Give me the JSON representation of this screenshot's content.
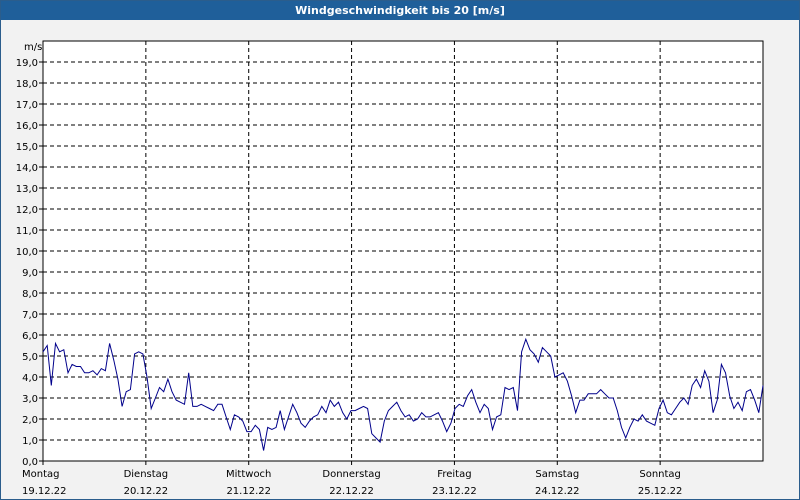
{
  "window": {
    "title": "Windgeschwindigkeit bis 20 [m/s]"
  },
  "colors": {
    "titlebar": "#1f5f9a",
    "series": "#00008b",
    "grid": "#000000",
    "plot_bg": "#ffffff"
  },
  "chart_data": {
    "type": "line",
    "title": "Windgeschwindigkeit bis 20 [m/s]",
    "ylabel": "m/s",
    "ylim": [
      0,
      20
    ],
    "yticks": [
      "0,0",
      "1,0",
      "2,0",
      "3,0",
      "4,0",
      "5,0",
      "6,0",
      "7,0",
      "8,0",
      "9,0",
      "10,0",
      "11,0",
      "12,0",
      "13,0",
      "14,0",
      "15,0",
      "16,0",
      "17,0",
      "18,0",
      "19,0"
    ],
    "xlim": [
      0,
      7
    ],
    "x_unit": "days from Montag 19.12.22",
    "xticks": [
      {
        "day": "Montag",
        "date": "19.12.22"
      },
      {
        "day": "Dienstag",
        "date": "20.12.22"
      },
      {
        "day": "Mittwoch",
        "date": "21.12.22"
      },
      {
        "day": "Donnerstag",
        "date": "22.12.22"
      },
      {
        "day": "Freitag",
        "date": "23.12.22"
      },
      {
        "day": "Samstag",
        "date": "24.12.22"
      },
      {
        "day": "Sonntag",
        "date": "25.12.22"
      }
    ],
    "grid": true,
    "series": [
      {
        "values": [
          5.2,
          5.5,
          3.6,
          5.6,
          5.2,
          5.3,
          4.2,
          4.6,
          4.5,
          4.5,
          4.2,
          4.2,
          4.3,
          4.1,
          4.4,
          4.3,
          5.6,
          4.8,
          3.9,
          2.6,
          3.3,
          3.4,
          5.1,
          5.2,
          5.1,
          4.0,
          2.5,
          3.0,
          3.5,
          3.3,
          3.9,
          3.3,
          2.9,
          2.8,
          2.7,
          4.2,
          2.6,
          2.6,
          2.7,
          2.6,
          2.5,
          2.4,
          2.7,
          2.7,
          2.1,
          1.5,
          2.2,
          2.1,
          1.9,
          1.4,
          1.4,
          1.7,
          1.5,
          0.5,
          1.6,
          1.5,
          1.6,
          2.4,
          1.5,
          2.1,
          2.7,
          2.3,
          1.8,
          1.6,
          1.9,
          2.1,
          2.2,
          2.6,
          2.3,
          2.9,
          2.6,
          2.8,
          2.3,
          2.0,
          2.4,
          2.4,
          2.5,
          2.6,
          2.5,
          1.3,
          1.1,
          0.9,
          1.9,
          2.4,
          2.6,
          2.8,
          2.4,
          2.1,
          2.2,
          1.9,
          2.0,
          2.3,
          2.1,
          2.1,
          2.2,
          2.3,
          1.9,
          1.4,
          1.8,
          2.5,
          2.7,
          2.6,
          3.1,
          3.4,
          2.8,
          2.3,
          2.7,
          2.5,
          1.5,
          2.1,
          2.2,
          3.5,
          3.4,
          3.5,
          2.4,
          5.2,
          5.8,
          5.3,
          5.1,
          4.7,
          5.4,
          5.2,
          5.0,
          4.0,
          4.1,
          4.2,
          3.8,
          3.1,
          2.3,
          2.9,
          2.9,
          3.2,
          3.2,
          3.2,
          3.4,
          3.2,
          3.0,
          3.0,
          2.4,
          1.6,
          1.1,
          1.6,
          2.0,
          1.9,
          2.2,
          1.9,
          1.8,
          1.7,
          2.5,
          2.9,
          2.3,
          2.2,
          2.5,
          2.8,
          3.0,
          2.7,
          3.6,
          3.9,
          3.5,
          4.3,
          3.8,
          2.3,
          2.9,
          4.6,
          4.2,
          3.1,
          2.5,
          2.8,
          2.4,
          3.3,
          3.4,
          2.9,
          2.3,
          3.6
        ]
      }
    ]
  }
}
